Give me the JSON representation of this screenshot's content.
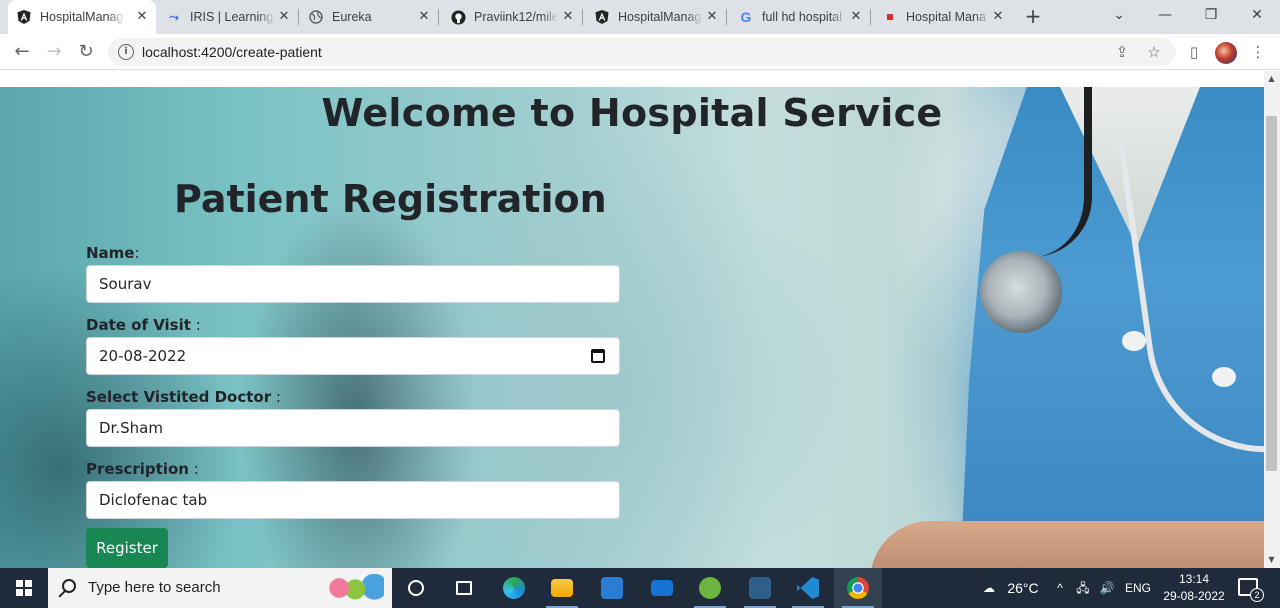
{
  "browser": {
    "tabs": [
      {
        "title": "HospitalManag",
        "favicon": "angular-icon",
        "active": true
      },
      {
        "title": "IRIS | Learning",
        "favicon": "iris-icon",
        "active": false
      },
      {
        "title": "Eureka",
        "favicon": "globe-icon",
        "active": false
      },
      {
        "title": "Praviink12/mile",
        "favicon": "github-icon",
        "active": false
      },
      {
        "title": "HospitalManag",
        "favicon": "angular-icon",
        "active": false
      },
      {
        "title": "full hd hospital",
        "favicon": "google-icon",
        "active": false
      },
      {
        "title": "Hospital Mana",
        "favicon": "red-square-icon",
        "active": false
      }
    ],
    "url": "localhost:4200/create-patient"
  },
  "page": {
    "welcome_heading": "Welcome to Hospital Service",
    "form_title": "Patient Registration",
    "fields": {
      "name": {
        "label": "Name",
        "colon": ":",
        "value": "Sourav"
      },
      "date_of_visit": {
        "label": "Date of Visit",
        "colon": " :",
        "value": "20-08-2022"
      },
      "doctor": {
        "label": "Select Vistited Doctor",
        "colon": " :",
        "value": "Dr.Sham"
      },
      "prescription": {
        "label": "Prescription",
        "colon": " :",
        "value": "Diclofenac tab"
      }
    },
    "register_button": "Register",
    "accent_color": "#198754"
  },
  "taskbar": {
    "search_placeholder": "Type here to search",
    "weather": "26°C",
    "language": "ENG",
    "time": "13:14",
    "date": "29-08-2022",
    "notification_count": "2",
    "apps": [
      "cortana-icon",
      "task-view-icon",
      "edge-icon",
      "file-explorer-icon",
      "store-icon",
      "mail-icon",
      "spring-icon",
      "mysql-workbench-icon",
      "vscode-icon",
      "chrome-icon"
    ]
  }
}
